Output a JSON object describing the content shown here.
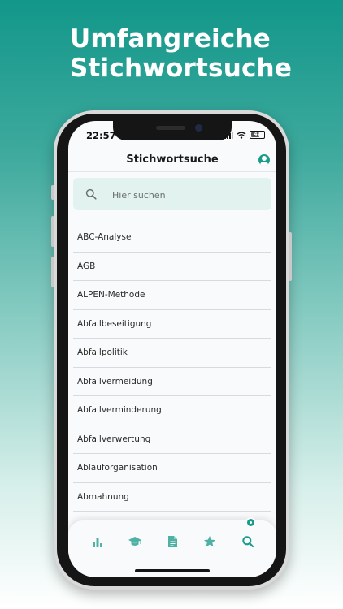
{
  "headline": {
    "line1": "Umfangreiche",
    "line2": "Stichwortsuche"
  },
  "status_bar": {
    "time": "22:57",
    "battery": "47"
  },
  "header": {
    "title": "Stichwortsuche",
    "profile_icon": "person-circle-icon"
  },
  "search": {
    "placeholder": "Hier suchen",
    "value": ""
  },
  "keywords": [
    "ABC-Analyse",
    "AGB",
    "ALPEN-Methode",
    "Abfallbeseitigung",
    "Abfallpolitik",
    "Abfallvermeidung",
    "Abfallverminderung",
    "Abfallverwertung",
    "Ablauforganisation",
    "Abmahnung"
  ],
  "tabbar": {
    "tabs": [
      {
        "icon": "bar-chart-icon",
        "active": false
      },
      {
        "icon": "graduation-cap-icon",
        "active": false
      },
      {
        "icon": "document-icon",
        "active": false
      },
      {
        "icon": "star-icon",
        "active": false
      },
      {
        "icon": "search-icon",
        "active": true
      }
    ]
  },
  "colors": {
    "accent": "#1a9c8c",
    "search_background": "#e2f2ee",
    "background_top": "#12978a"
  }
}
